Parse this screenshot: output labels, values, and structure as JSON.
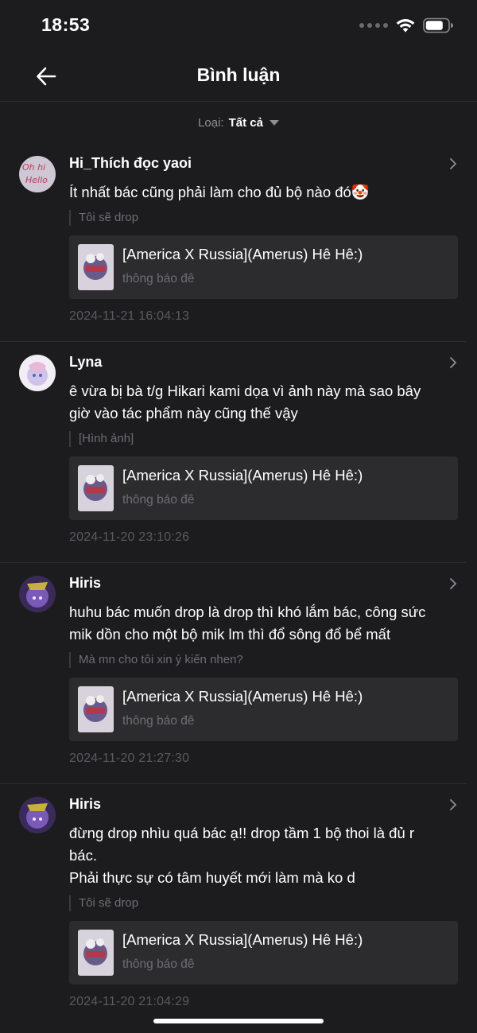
{
  "status_bar": {
    "time": "18:53"
  },
  "header": {
    "title": "Bình luận"
  },
  "filter": {
    "label": "Loại:",
    "value": "Tất cả"
  },
  "comments": [
    {
      "username": "Hi_Thích đọc yaoi",
      "text": "Ít nhất bác cũng phải làm cho đủ bộ nào đó🤡",
      "quote": "Tôi sẽ drop",
      "work_title": "[America X Russia](Amerus) Hê Hê:)",
      "work_subtitle": "thông báo đê",
      "time": "2024-11-21 16:04:13",
      "avatar_text": "Oh hi Hello"
    },
    {
      "username": "Lyna",
      "text": "ê vừa bị bà t/g Hikari kami dọa vì ảnh này mà sao bây giờ vào tác phẩm này cũng thế vậy",
      "quote": "[Hình ảnh]",
      "work_title": "[America X Russia](Amerus) Hê Hê:)",
      "work_subtitle": "thông báo đê",
      "time": "2024-11-20 23:10:26"
    },
    {
      "username": "Hiris",
      "text": "huhu bác muốn drop là drop thì khó lắm bác, công sức mik dồn cho một bộ mik lm thì đổ sông đổ bể mất",
      "quote": "Mà mn cho tôi xin ý kiến nhen?",
      "work_title": "[America X Russia](Amerus) Hê Hê:)",
      "work_subtitle": "thông báo đê",
      "time": "2024-11-20 21:27:30"
    },
    {
      "username": "Hiris",
      "text": "đừng drop nhìu quá bác ạ!! drop tầm 1 bộ thoi là đủ r bác.\nPhải thực sự có tâm huyết mới làm mà ko d",
      "quote": "Tôi sẽ drop",
      "work_title": "[America X Russia](Amerus) Hê Hê:)",
      "work_subtitle": "thông báo đê",
      "time": "2024-11-20 21:04:29"
    }
  ],
  "icons": {
    "back": "arrow-left-icon",
    "chevron": "chevron-right-icon",
    "wifi": "wifi-icon",
    "battery": "battery-icon"
  },
  "colors": {
    "background": "#1c1c1e",
    "card": "#2c2c2e",
    "muted": "#6e6e73"
  }
}
